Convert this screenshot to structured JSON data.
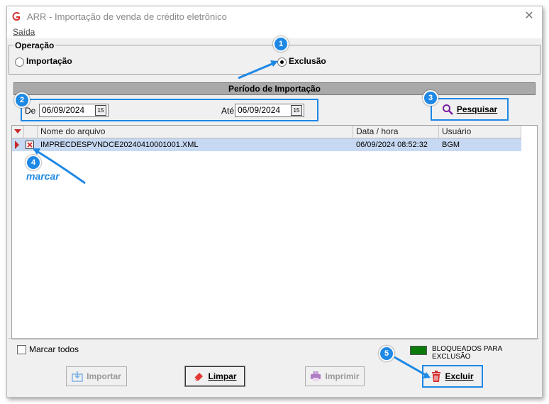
{
  "window": {
    "title": "ARR - Importação de venda de crédito eletrônico",
    "close": "✕"
  },
  "menu": {
    "exit": "Saída"
  },
  "operation": {
    "legend": "Operação",
    "options": [
      {
        "label": "Importação",
        "checked": false
      },
      {
        "label": "Exclusão",
        "checked": true
      }
    ]
  },
  "period": {
    "title": "Período de Importação",
    "from_label": "De",
    "from_value": "06/09/2024",
    "to_label": "Até",
    "to_value": "06/09/2024",
    "calendar_glyph": "15"
  },
  "search_button": "Pesquisar",
  "table": {
    "columns": [
      "Nome do arquivo",
      "Data / hora",
      "Usuário"
    ],
    "rows": [
      {
        "file": "IMPRECDESPVNDCE20240410001001.XML",
        "datetime": "06/09/2024 08:52:32",
        "user": "BGM",
        "checked": true
      }
    ]
  },
  "annotations": {
    "step1": "1",
    "step2": "2",
    "step3": "3",
    "step4": "4",
    "step5": "5",
    "marcar": "marcar"
  },
  "mark_all": "Marcar todos",
  "legend": {
    "text": "BLOQUEADOS PARA EXCLUSÃO",
    "color": "#0a7a0a"
  },
  "buttons": {
    "import": "Importar",
    "clear": "Limpar",
    "print": "Imprimir",
    "delete": "Excluir"
  },
  "colors": {
    "accent": "#1e88e5",
    "selected_row": "#c7d9f2",
    "delete_icon": "#d32f2f"
  }
}
